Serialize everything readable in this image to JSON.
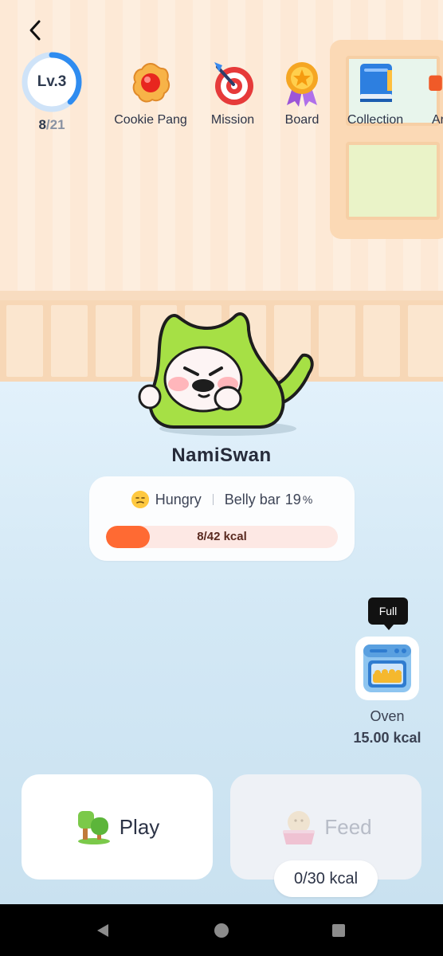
{
  "header": {
    "level_label": "Lv.3",
    "xp_current": "8",
    "xp_total": "/21",
    "xp_progress": 0.38
  },
  "menu": [
    {
      "label": "Cookie Pang",
      "icon": "cookie-icon"
    },
    {
      "label": "Mission",
      "icon": "target-icon"
    },
    {
      "label": "Board",
      "icon": "medal-icon"
    },
    {
      "label": "Collection",
      "icon": "book-icon"
    },
    {
      "label": "Ar",
      "icon": "partial-icon"
    }
  ],
  "pet": {
    "name": "NamiSwan"
  },
  "status": {
    "mood": "Hungry",
    "belly_label": "Belly bar",
    "belly_value": "19",
    "belly_unit": "%",
    "kcal_text": "8/42 kcal",
    "kcal_progress": 0.19
  },
  "oven": {
    "tooltip": "Full",
    "label": "Oven",
    "kcal": "15.00 kcal"
  },
  "actions": {
    "play_label": "Play",
    "feed_label": "Feed",
    "feed_kcal": "0/30 kcal"
  },
  "colors": {
    "accent_blue": "#2f8cf0",
    "bar_orange": "#ff6a33",
    "pet_green": "#a6e045"
  }
}
